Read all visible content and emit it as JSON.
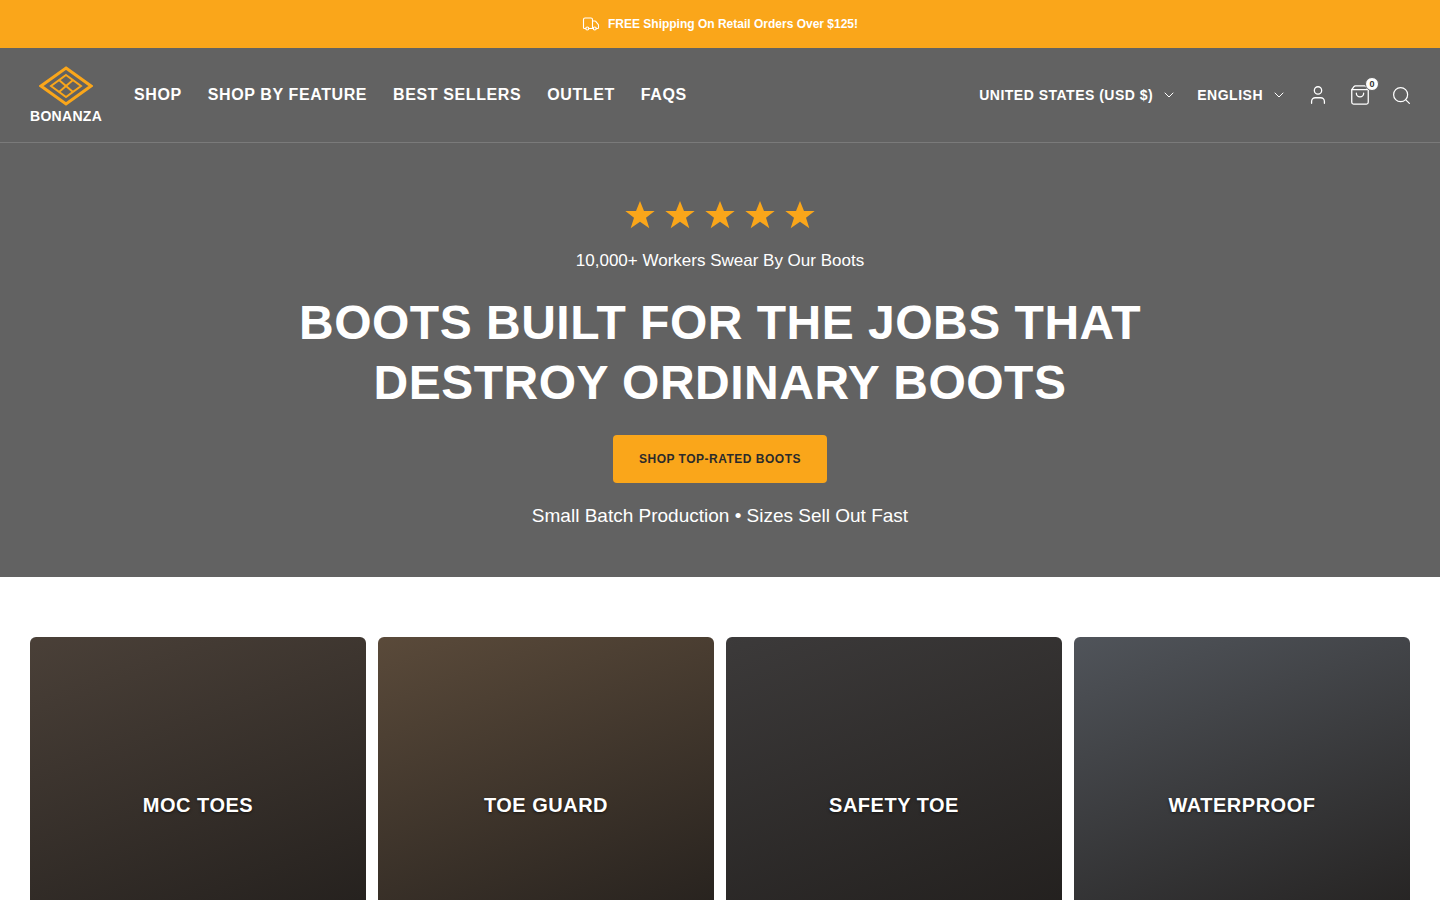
{
  "announcement": {
    "text": "FREE Shipping On Retail Orders Over $125!"
  },
  "header": {
    "logo": "BONANZA",
    "nav": [
      {
        "label": "SHOP"
      },
      {
        "label": "SHOP BY FEATURE"
      },
      {
        "label": "BEST SELLERS"
      },
      {
        "label": "OUTLET"
      },
      {
        "label": "FAQS"
      }
    ],
    "country": "UNITED STATES (USD $)",
    "language": "ENGLISH",
    "cart_count": "0"
  },
  "hero": {
    "stars": 5,
    "tagline": "10,000+ Workers Swear By Our Boots",
    "title": "BOOTS BUILT FOR THE JOBS THAT DESTROY ORDINARY BOOTS",
    "button": "SHOP TOP-RATED BOOTS",
    "note": "Small Batch Production • Sizes Sell Out Fast"
  },
  "categories": [
    {
      "label": "MOC TOES",
      "color": "#4a4038"
    },
    {
      "label": "TOE GUARD",
      "color": "#5a4a3a"
    },
    {
      "label": "SAFETY TOE",
      "color": "#3c3a3a"
    },
    {
      "label": "WATERPROOF",
      "color": "#50545a"
    }
  ]
}
